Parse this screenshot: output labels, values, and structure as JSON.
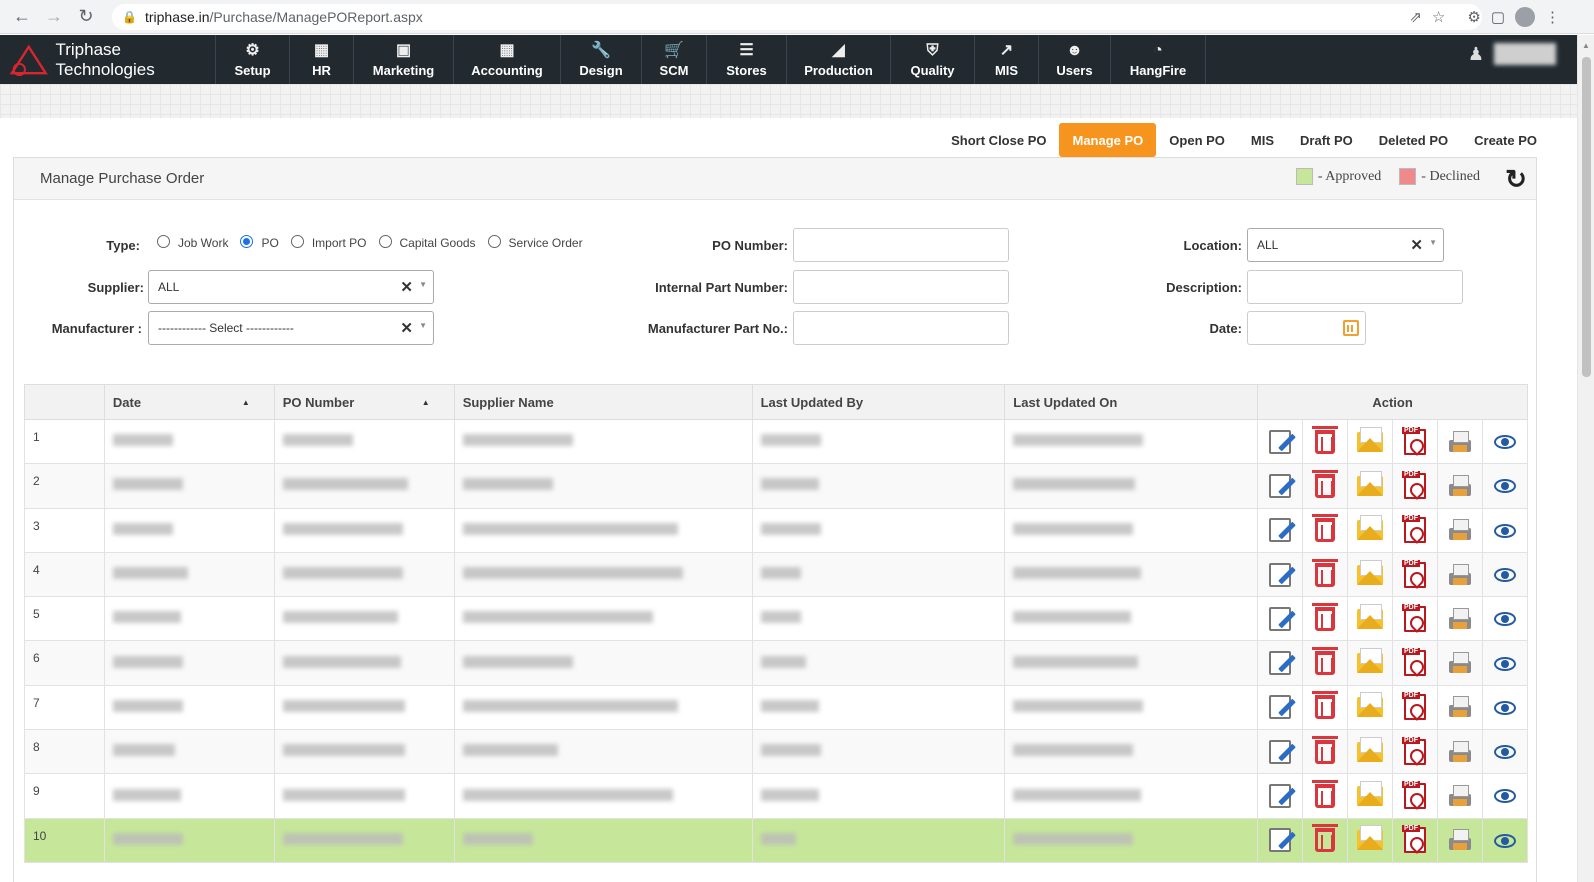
{
  "browser": {
    "url_host": "triphase.in",
    "url_path": "/Purchase/ManagePOReport.aspx"
  },
  "app": {
    "brand": "Triphase Technologies",
    "nav": [
      {
        "label": "Setup",
        "icon": "gear-icon"
      },
      {
        "label": "HR",
        "icon": "org-chart-icon"
      },
      {
        "label": "Marketing",
        "icon": "briefcase-icon"
      },
      {
        "label": "Accounting",
        "icon": "calculator-icon"
      },
      {
        "label": "Design",
        "icon": "wrench-icon"
      },
      {
        "label": "SCM",
        "icon": "cart-icon"
      },
      {
        "label": "Stores",
        "icon": "database-icon"
      },
      {
        "label": "Production",
        "icon": "cubes-icon"
      },
      {
        "label": "Quality",
        "icon": "shield-icon"
      },
      {
        "label": "MIS",
        "icon": "line-chart-icon"
      },
      {
        "label": "Users",
        "icon": "users-icon"
      },
      {
        "label": "HangFire",
        "icon": "dashboard-icon"
      }
    ]
  },
  "tabs": [
    "Short Close PO",
    "Manage PO",
    "Open PO",
    "MIS",
    "Draft PO",
    "Deleted PO",
    "Create PO"
  ],
  "active_tab": "Manage PO",
  "panel": {
    "title": "Manage Purchase Order",
    "legend_approved": "- Approved",
    "legend_declined": "- Declined",
    "approved_color": "#c6e79a",
    "declined_color": "#f08a8a"
  },
  "filters": {
    "type_label": "Type:",
    "type_options": [
      "Job Work",
      "PO",
      "Import PO",
      "Capital Goods",
      "Service Order"
    ],
    "type_selected": "PO",
    "supplier_label": "Supplier:",
    "supplier_value": "ALL",
    "manufacturer_label": "Manufacturer :",
    "manufacturer_value": "------------ Select ------------",
    "po_number_label": "PO Number:",
    "internal_part_label": "Internal Part Number:",
    "mfr_part_label": "Manufacturer Part No.:",
    "location_label": "Location:",
    "location_value": "ALL",
    "description_label": "Description:",
    "date_label": "Date:"
  },
  "table": {
    "columns": [
      "Date",
      "PO Number",
      "Supplier Name",
      "Last Updated By",
      "Last Updated On",
      "Action"
    ],
    "rows": [
      {
        "n": "1"
      },
      {
        "n": "2"
      },
      {
        "n": "3"
      },
      {
        "n": "4"
      },
      {
        "n": "5"
      },
      {
        "n": "6"
      },
      {
        "n": "7"
      },
      {
        "n": "8"
      },
      {
        "n": "9"
      },
      {
        "n": "10"
      }
    ],
    "approved_row": "10"
  }
}
